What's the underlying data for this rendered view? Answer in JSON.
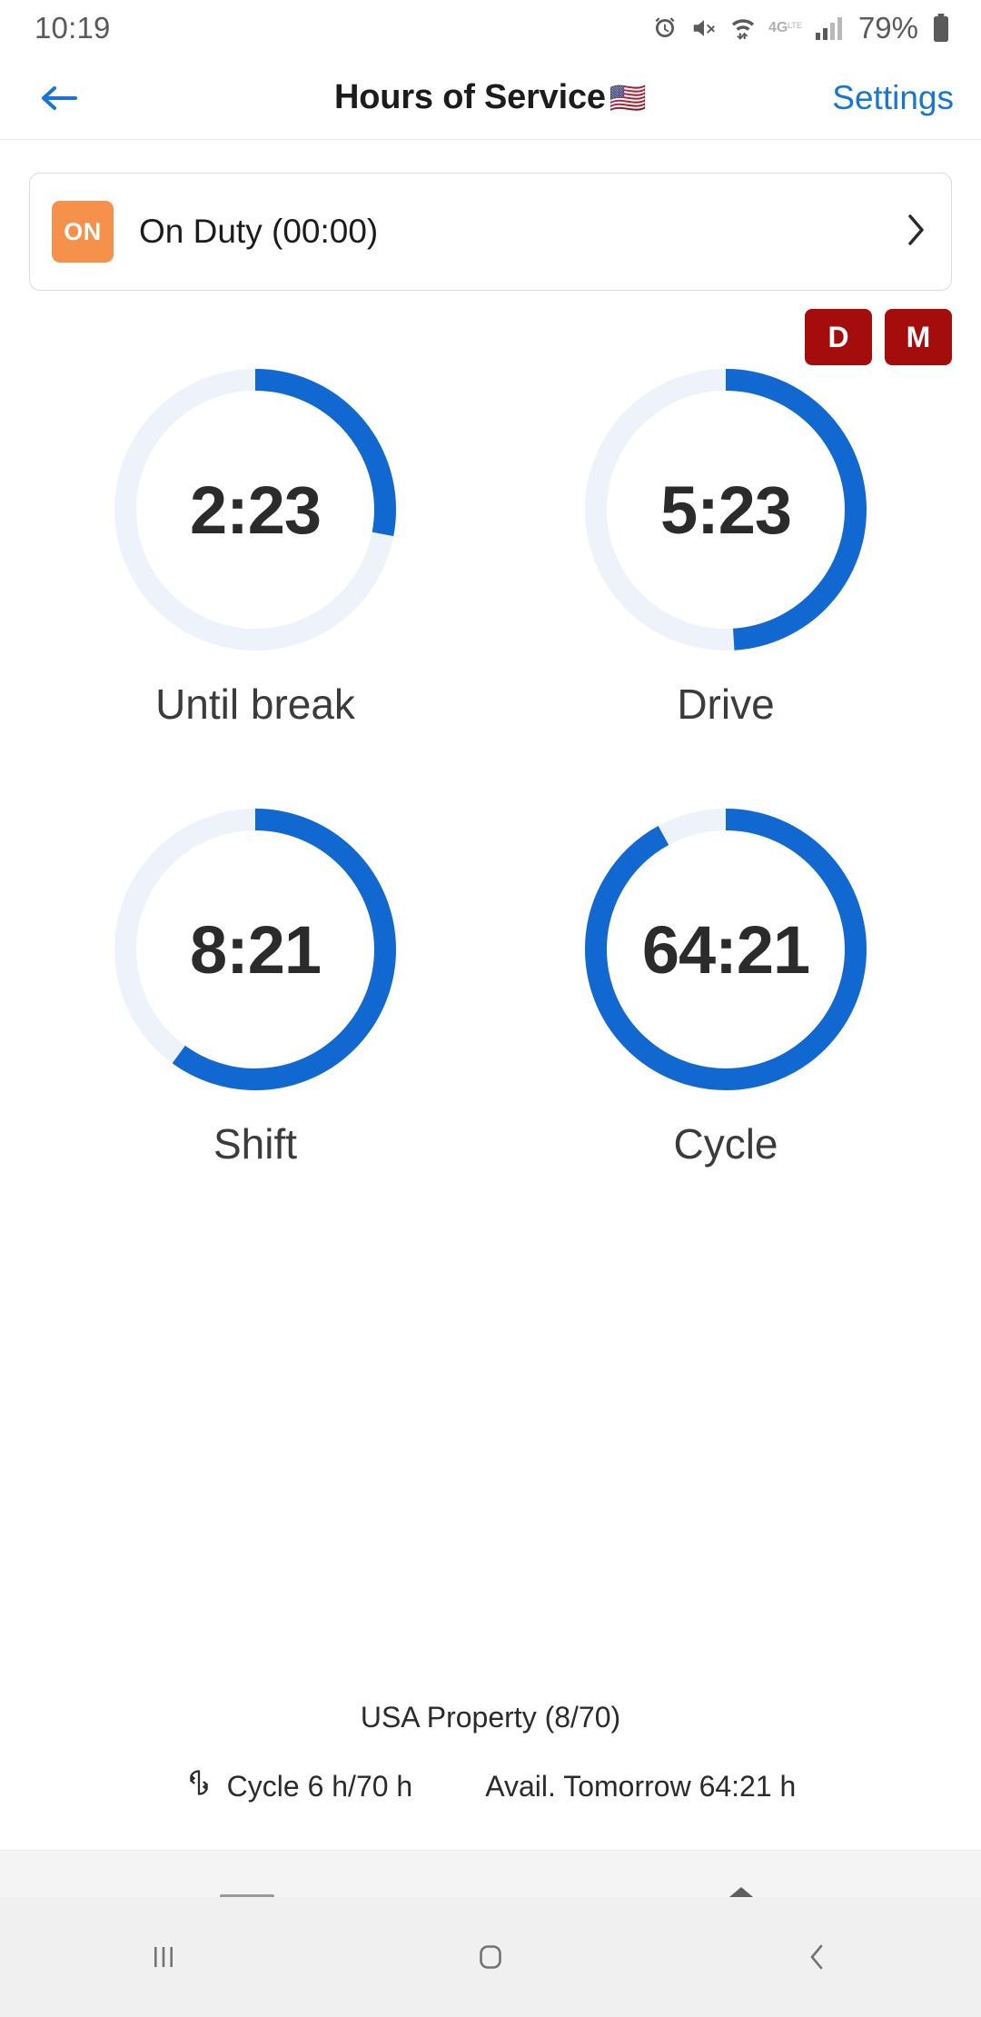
{
  "statusbar": {
    "time": "10:19",
    "battery_percent": "79%",
    "icons": [
      "alarm-icon",
      "mute-icon",
      "wifi-icon",
      "4g-lte-icon",
      "signal-icon",
      "battery-icon"
    ]
  },
  "appbar": {
    "back_label": "back-arrow",
    "title": "Hours of Service",
    "flag": "🇺🇸",
    "settings_label": "Settings",
    "settings_color": "#1876d2"
  },
  "duty_card": {
    "badge": "ON",
    "badge_color": "#f5914a",
    "label": "On Duty (00:00)",
    "chevron": "chevron-right-icon"
  },
  "mode_buttons": [
    {
      "label": "D",
      "name": "day-mode-button"
    },
    {
      "label": "M",
      "name": "month-mode-button"
    }
  ],
  "mode_button_color": "#a50c0c",
  "gauges": [
    {
      "value": "2:23",
      "caption": "Until break",
      "percent": 28,
      "track_color": "#eef2fa",
      "arc_color": "#1068d0"
    },
    {
      "value": "5:23",
      "caption": "Drive",
      "percent": 49,
      "track_color": "#eef2fa",
      "arc_color": "#1068d0"
    },
    {
      "value": "8:21",
      "caption": "Shift",
      "percent": 60,
      "track_color": "#eef2fa",
      "arc_color": "#1068d0"
    },
    {
      "value": "64:21",
      "caption": "Cycle",
      "percent": 92,
      "track_color": "#eef2fa",
      "arc_color": "#1068d0"
    }
  ],
  "footer": {
    "title": "USA Property (8/70)",
    "cycle_text": "Cycle 6 h/70 h",
    "cycle_icon": "refresh-cycle-icon",
    "avail_text": "Avail. Tomorrow 64:21 h"
  },
  "navbar": {
    "recents": "recents-icon",
    "home": "home-icon",
    "back": "back-icon"
  },
  "chart_data": {
    "type": "pie",
    "title": "Hours of Service gauges",
    "series": [
      {
        "name": "Until break",
        "value_text": "2:23",
        "percent": 28
      },
      {
        "name": "Drive",
        "value_text": "5:23",
        "percent": 49
      },
      {
        "name": "Shift",
        "value_text": "8:21",
        "percent": 60
      },
      {
        "name": "Cycle",
        "value_text": "64:21",
        "percent": 92
      }
    ]
  }
}
